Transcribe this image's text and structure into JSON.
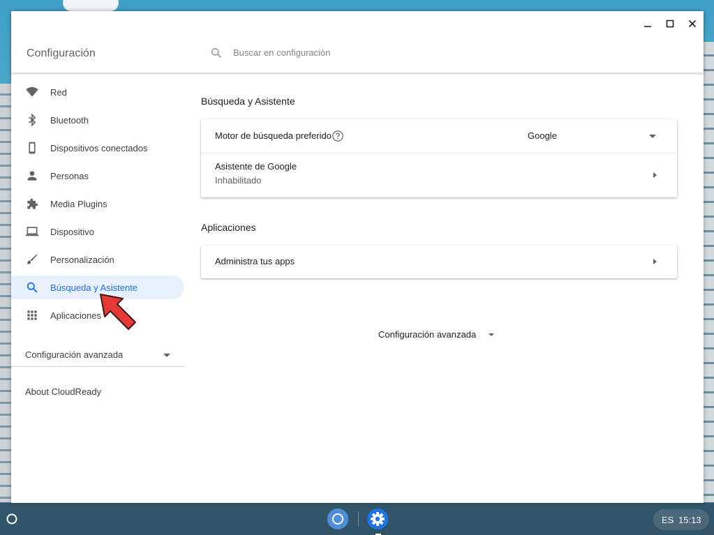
{
  "window": {
    "title": "Configuración",
    "search_placeholder": "Buscar en configuración"
  },
  "sidebar": {
    "items": [
      {
        "label": "Red",
        "icon": "wifi-icon"
      },
      {
        "label": "Bluetooth",
        "icon": "bluetooth-icon"
      },
      {
        "label": "Dispositivos conectados",
        "icon": "phone-icon"
      },
      {
        "label": "Personas",
        "icon": "person-icon"
      },
      {
        "label": "Media Plugins",
        "icon": "puzzle-icon"
      },
      {
        "label": "Dispositivo",
        "icon": "laptop-icon"
      },
      {
        "label": "Personalización",
        "icon": "brush-icon"
      },
      {
        "label": "Búsqueda y Asistente",
        "icon": "search-icon",
        "active": true
      },
      {
        "label": "Aplicaciones",
        "icon": "apps-grid-icon"
      }
    ],
    "advanced_label": "Configuración avanzada",
    "about_label": "About CloudReady"
  },
  "main": {
    "search_section": {
      "title": "Búsqueda y Asistente",
      "engine_label": "Motor de búsqueda preferido",
      "engine_value": "Google",
      "assistant_label": "Asistente de Google",
      "assistant_status": "Inhabilitado"
    },
    "apps_section": {
      "title": "Aplicaciones",
      "manage_label": "Administra tus apps"
    },
    "advanced_label": "Configuración avanzada"
  },
  "shelf": {
    "language": "ES",
    "time": "15:13"
  },
  "colors": {
    "accent": "#1a73e8",
    "active_bg": "#e8f0fe",
    "pointer": "#e53935"
  }
}
